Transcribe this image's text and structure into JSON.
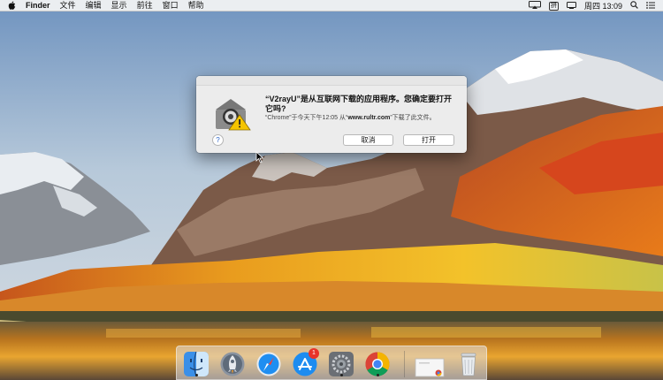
{
  "menubar": {
    "app_name": "Finder",
    "items": [
      "文件",
      "编辑",
      "显示",
      "前往",
      "窗口",
      "帮助"
    ],
    "ime_label": "拼",
    "clock": "周四 13:09"
  },
  "dialog": {
    "title": "“V2rayU”是从互联网下载的应用程序。您确定要打开它吗?",
    "description_prefix": "“Chrome”于今天下午12:05 从“",
    "description_source": "www.rultr.com",
    "description_suffix": "”下载了此文件。",
    "help_label": "?",
    "cancel_label": "取消",
    "open_label": "打开"
  },
  "dock": {
    "apps": [
      "finder-icon",
      "launchpad-icon",
      "safari-icon",
      "app-store-icon",
      "system-preferences-icon",
      "chrome-icon"
    ],
    "app_store_badge": "1"
  },
  "colors": {
    "accent": "#2a63c7",
    "badge": "#e8332a"
  }
}
